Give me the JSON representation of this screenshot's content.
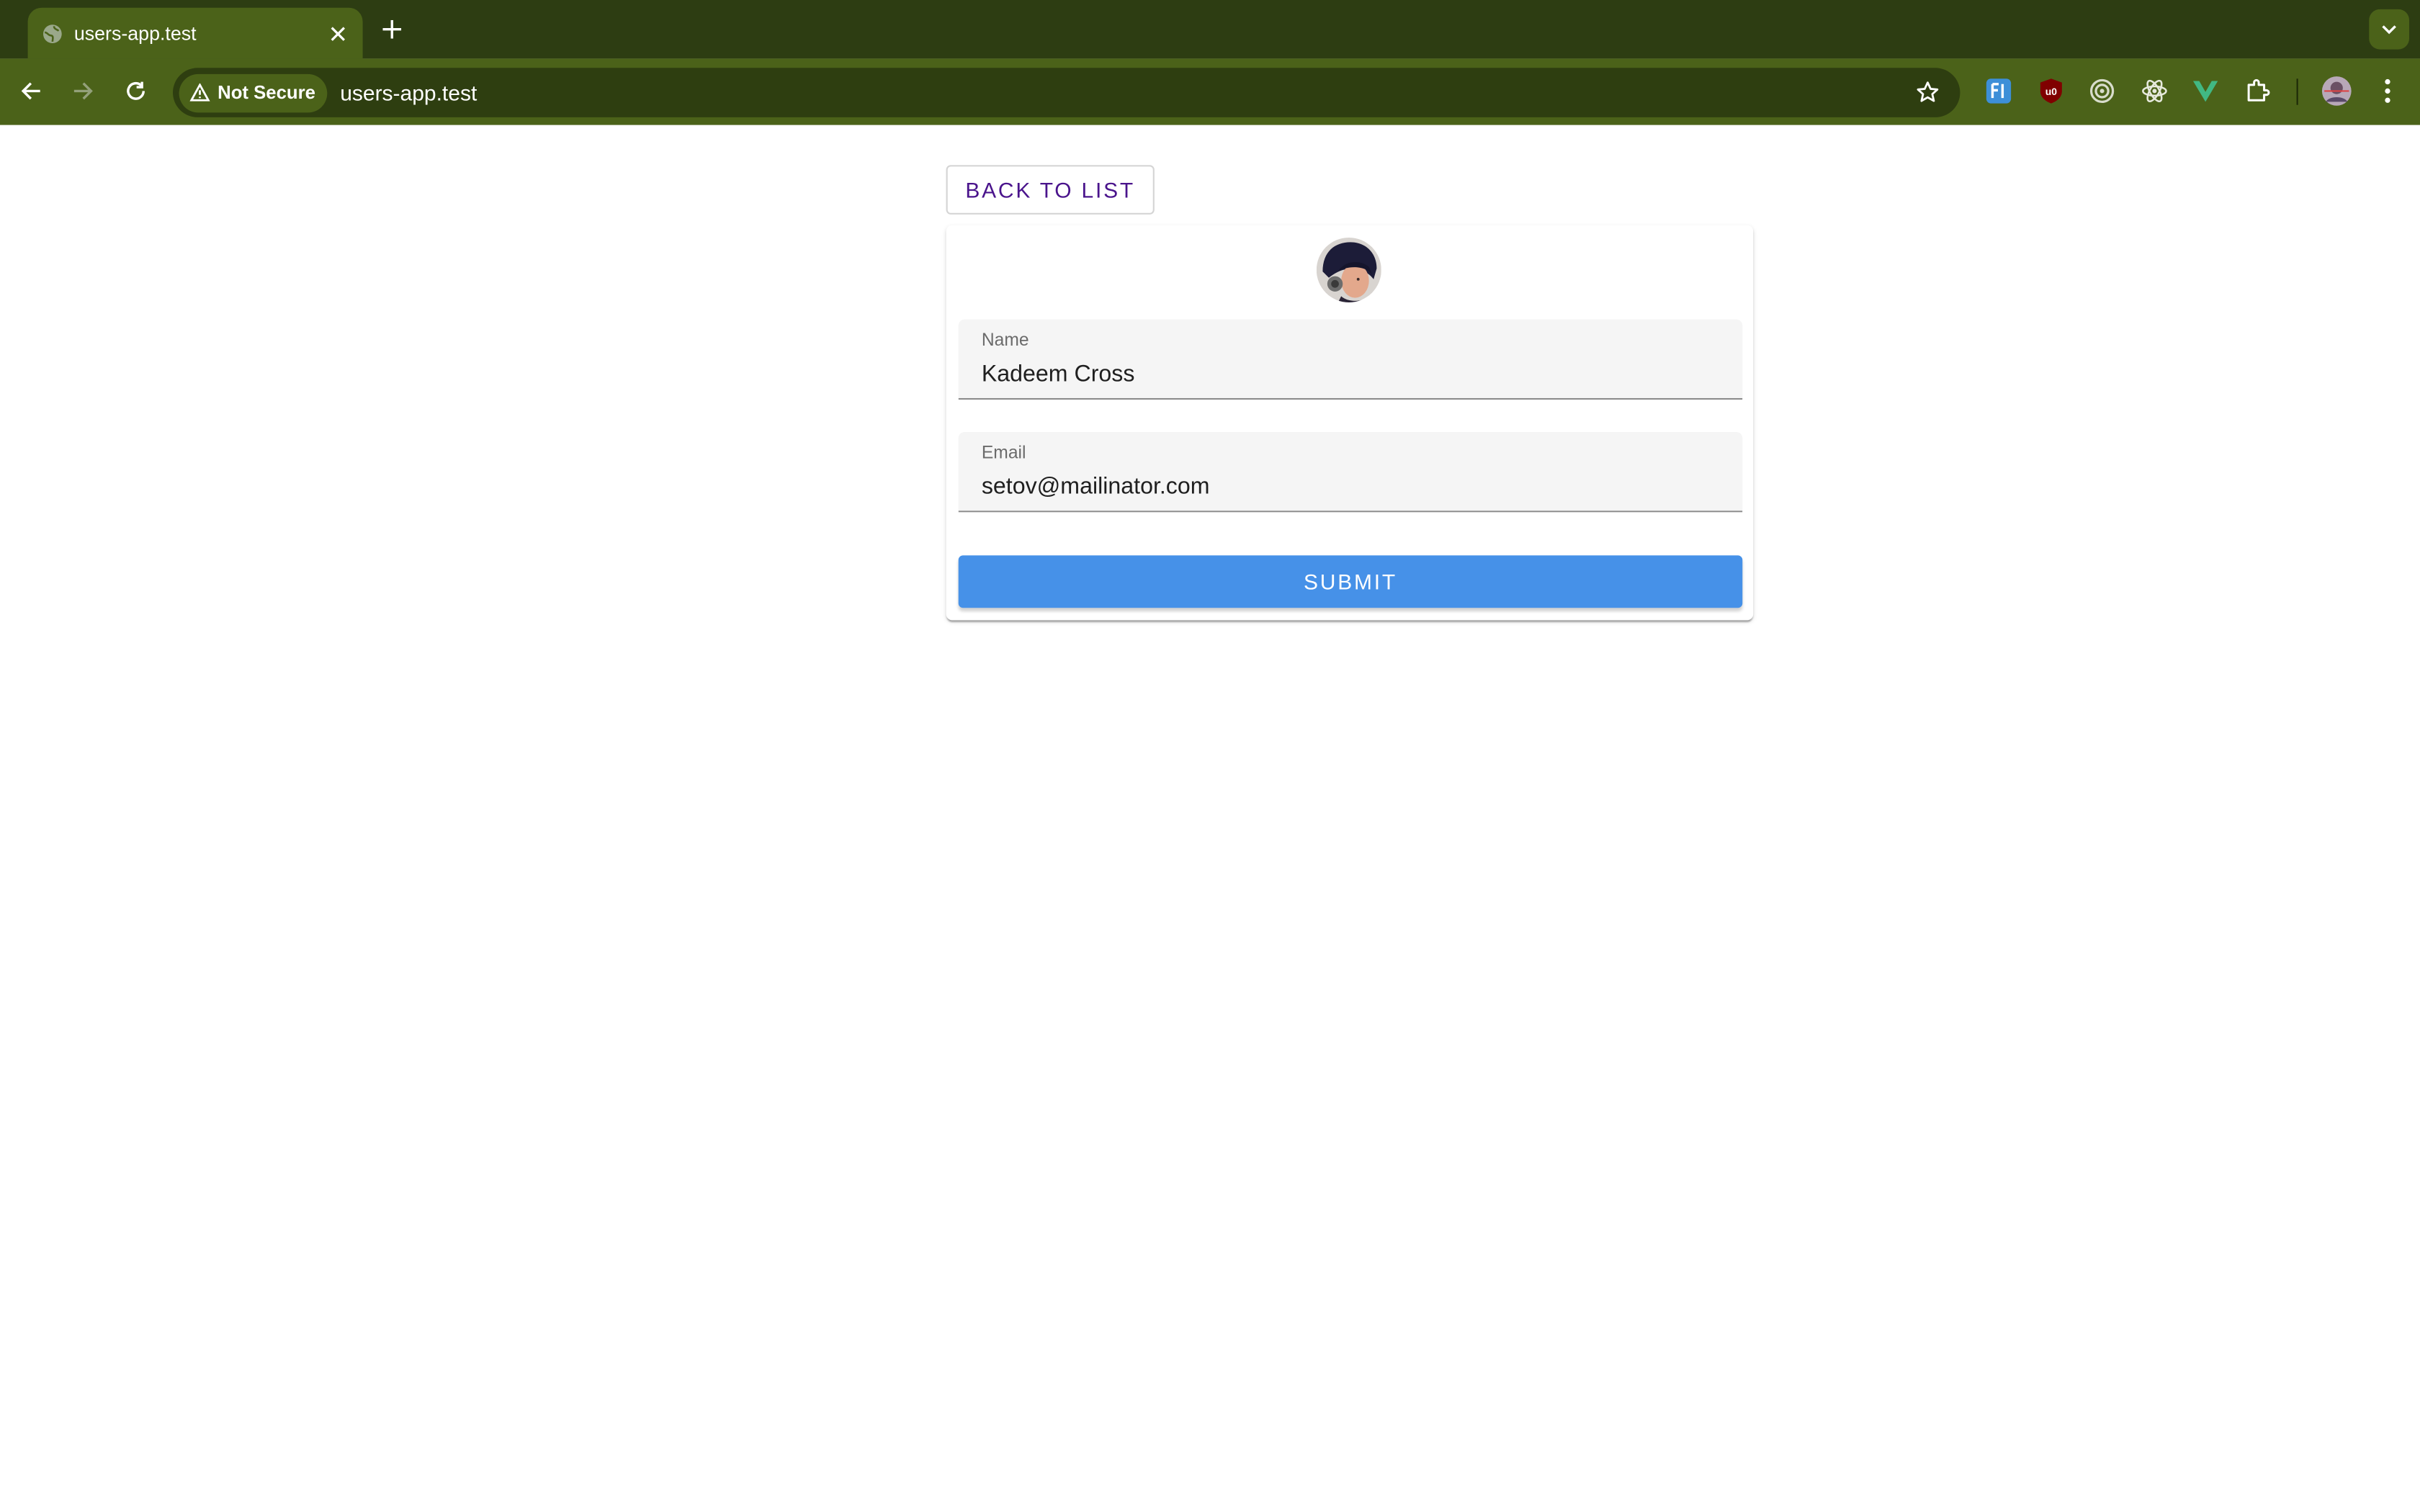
{
  "browser": {
    "tab_title": "users-app.test",
    "security_label": "Not Secure",
    "url": "users-app.test",
    "theme_colors": {
      "tabstrip": "#2d3d12",
      "toolbar": "#4b6219",
      "omnibox": "#2e3e10"
    },
    "extensions": [
      "fi-extension-icon",
      "ublock-icon",
      "target-extension-icon",
      "react-devtools-icon",
      "vue-devtools-icon",
      "extensions-puzzle-icon"
    ]
  },
  "page": {
    "back_label": "BACK TO LIST",
    "form": {
      "name_label": "Name",
      "name_value": "Kadeem Cross",
      "email_label": "Email",
      "email_value": "setov@mailinator.com",
      "submit_label": "SUBMIT"
    },
    "colors": {
      "accent": "#4691e8",
      "back_text": "#4a148c"
    }
  }
}
